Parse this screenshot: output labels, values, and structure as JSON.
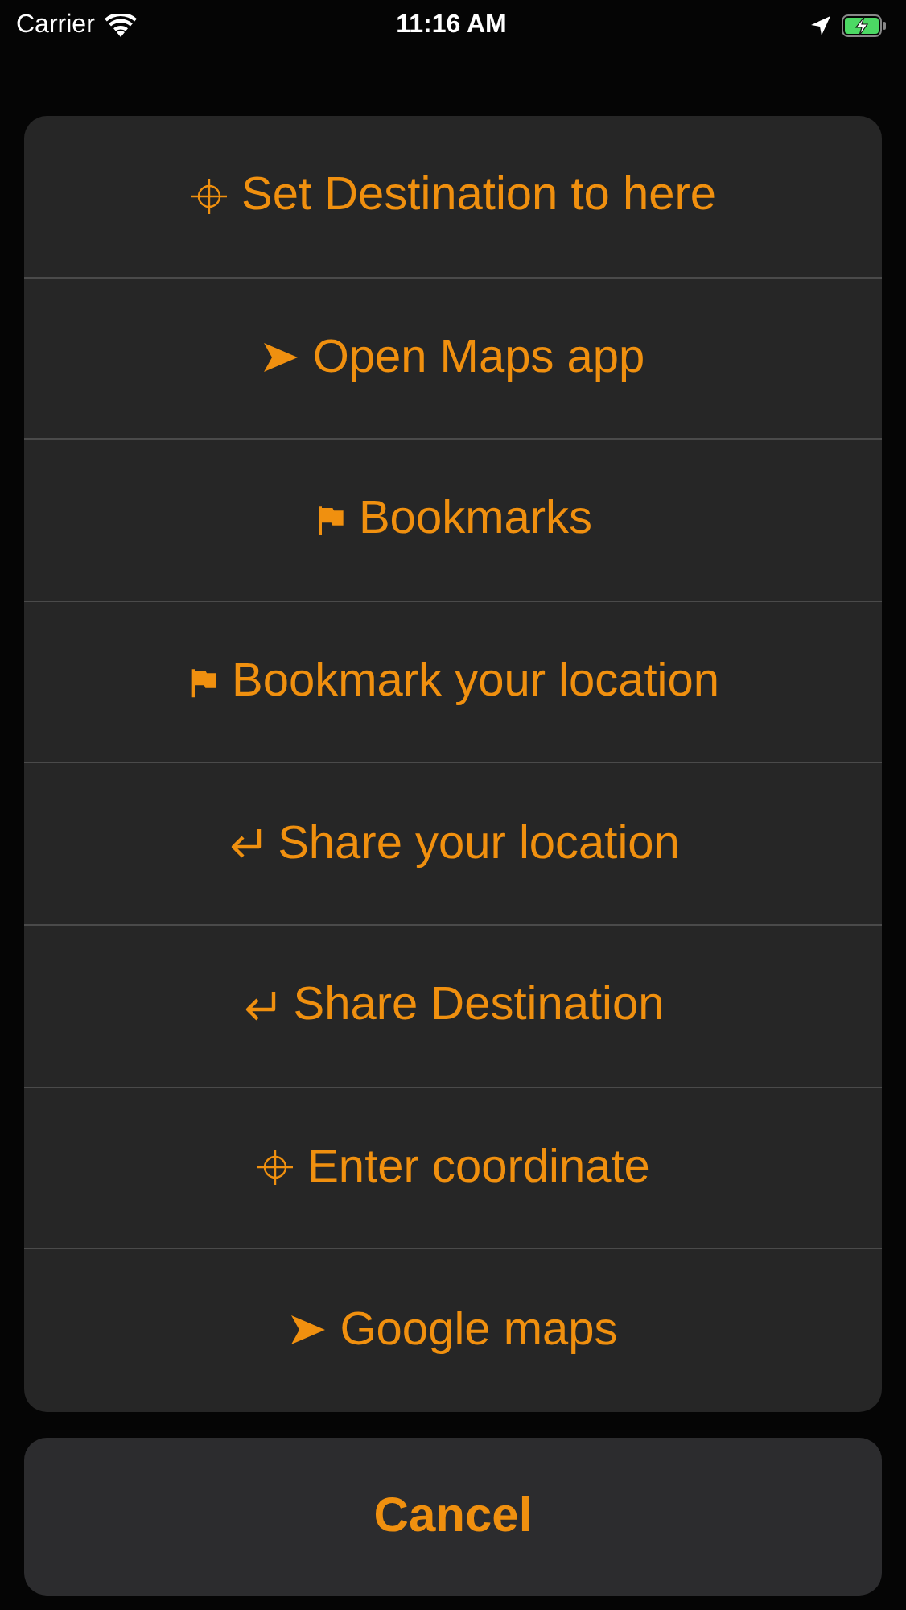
{
  "status_bar": {
    "carrier": "Carrier",
    "time": "11:16 AM"
  },
  "action_sheet": {
    "items": [
      {
        "kind": "target",
        "label": "Set Destination to here"
      },
      {
        "kind": "navigate",
        "label": "Open Maps app"
      },
      {
        "kind": "flag",
        "label": "Bookmarks"
      },
      {
        "kind": "flag",
        "label": "Bookmark your location"
      },
      {
        "kind": "share",
        "label": "Share your location"
      },
      {
        "kind": "share",
        "label": "Share Destination"
      },
      {
        "kind": "target",
        "label": "Enter coordinate"
      },
      {
        "kind": "navigate",
        "label": "Google maps"
      }
    ],
    "cancel": "Cancel"
  }
}
